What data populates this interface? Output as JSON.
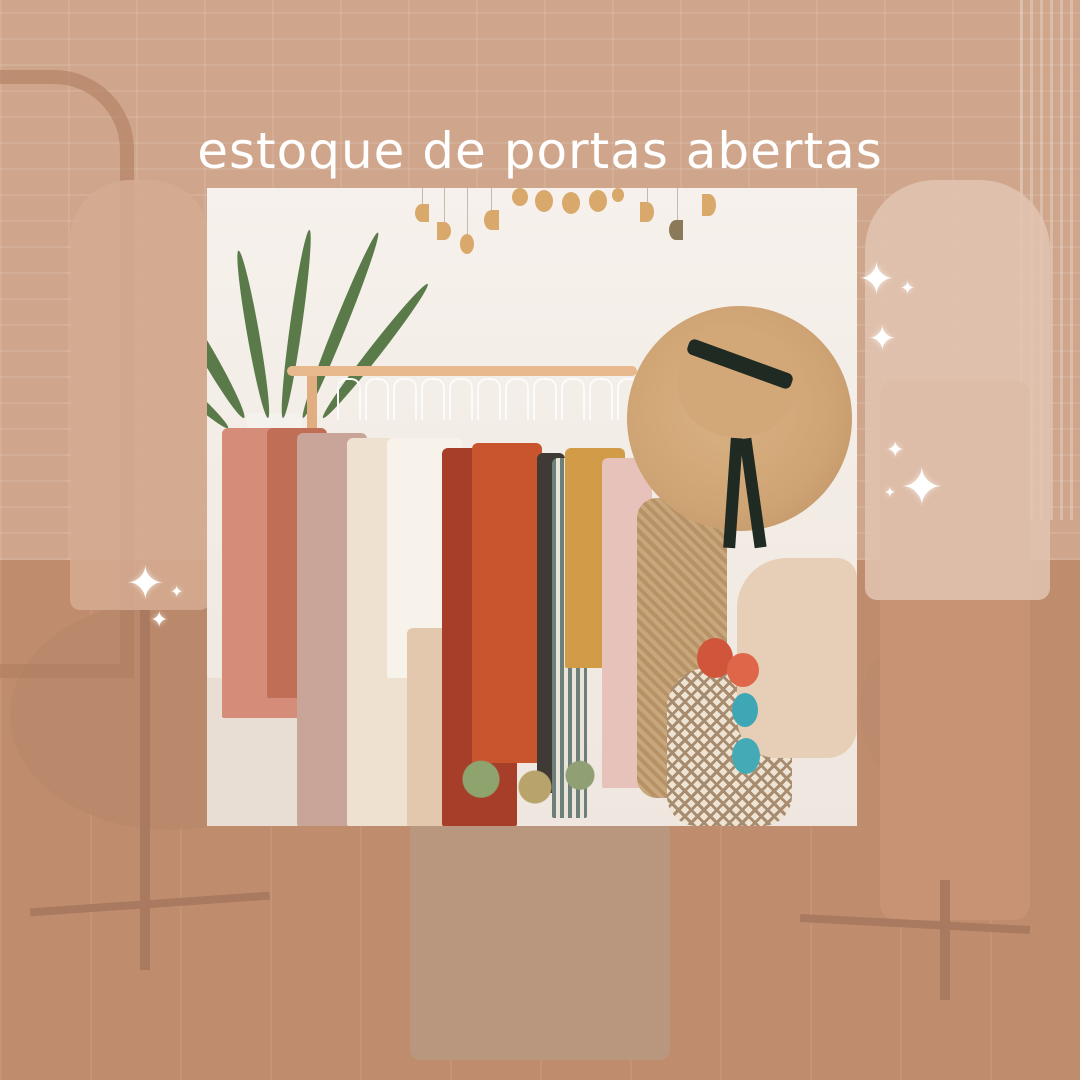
{
  "post": {
    "headline": "estoque de portas abertas"
  },
  "colors": {
    "overlay": "#c49578",
    "headline_text": "#ffffff"
  },
  "icons": {
    "sparkle": "sparkle-icon",
    "sparkle_glyph": "✦"
  }
}
